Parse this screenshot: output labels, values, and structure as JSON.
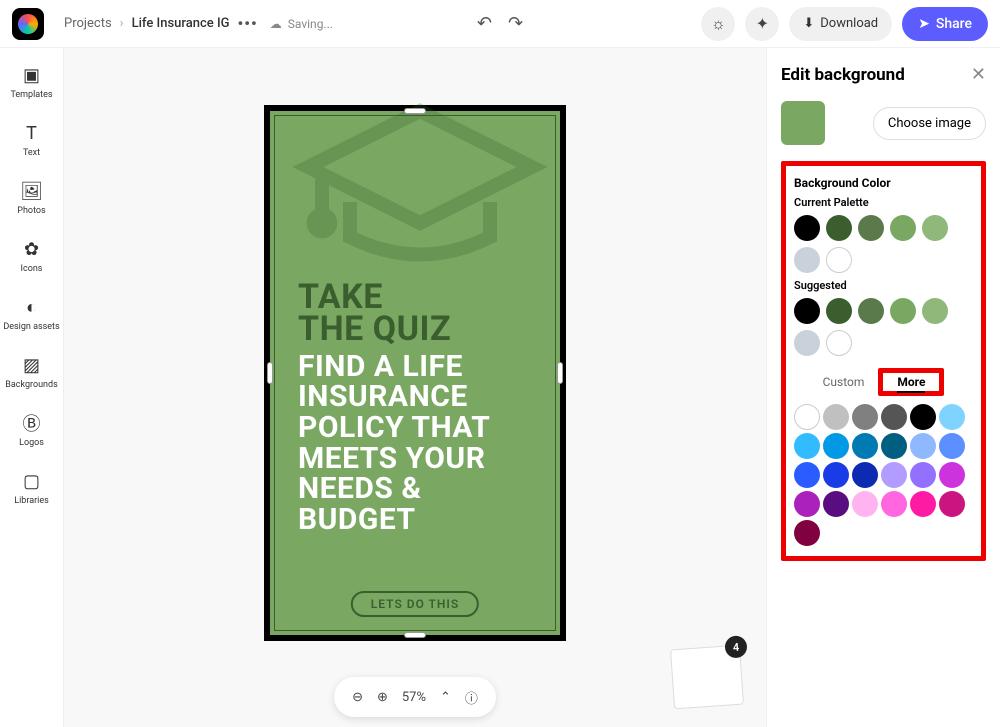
{
  "header": {
    "projects": "Projects",
    "title": "Life Insurance IG",
    "saving": "Saving...",
    "download": "Download",
    "share": "Share"
  },
  "nav": [
    {
      "label": "Templates"
    },
    {
      "label": "Text"
    },
    {
      "label": "Photos"
    },
    {
      "label": "Icons"
    },
    {
      "label": "Design assets"
    },
    {
      "label": "Backgrounds"
    },
    {
      "label": "Logos"
    },
    {
      "label": "Libraries"
    }
  ],
  "canvas": {
    "headline1": "TAKE",
    "headline2": "THE QUIZ",
    "body": "FIND A LIFE INSURANCE POLICY THAT MEETS YOUR NEEDS & BUDGET",
    "cta": "LETS DO THIS"
  },
  "zoom": {
    "value": "57%"
  },
  "pages": {
    "count": "4"
  },
  "panel": {
    "title": "Edit background",
    "choose": "Choose image",
    "bgcolor": "Background Color",
    "palette": "Current Palette",
    "suggested": "Suggested",
    "custom": "Custom",
    "more": "More",
    "palette_colors": [
      "#000000",
      "#3a5e2e",
      "#5a7a4c",
      "#7aa862",
      "#8fb87a",
      "#c9d2da",
      "#ffffff"
    ],
    "suggested_colors": [
      "#000000",
      "#3a5e2e",
      "#5a7a4c",
      "#7aa862",
      "#8fb87a",
      "#c9d2da",
      "#ffffff"
    ],
    "more_colors": [
      "#ffffff",
      "#c0c0c0",
      "#808080",
      "#555555",
      "#000000",
      "#7fd4ff",
      "#33bbff",
      "#0099e6",
      "#007ab3",
      "#005f80",
      "#8fb8ff",
      "#5c8fff",
      "#2b5cff",
      "#1a3ce6",
      "#0d2ab3",
      "#b39cff",
      "#9370ff",
      "#cc33dd",
      "#aa22bb",
      "#5a0d80",
      "#ffb3f0",
      "#ff66e0",
      "#ff1aa6",
      "#cc1480",
      "#800040"
    ]
  }
}
